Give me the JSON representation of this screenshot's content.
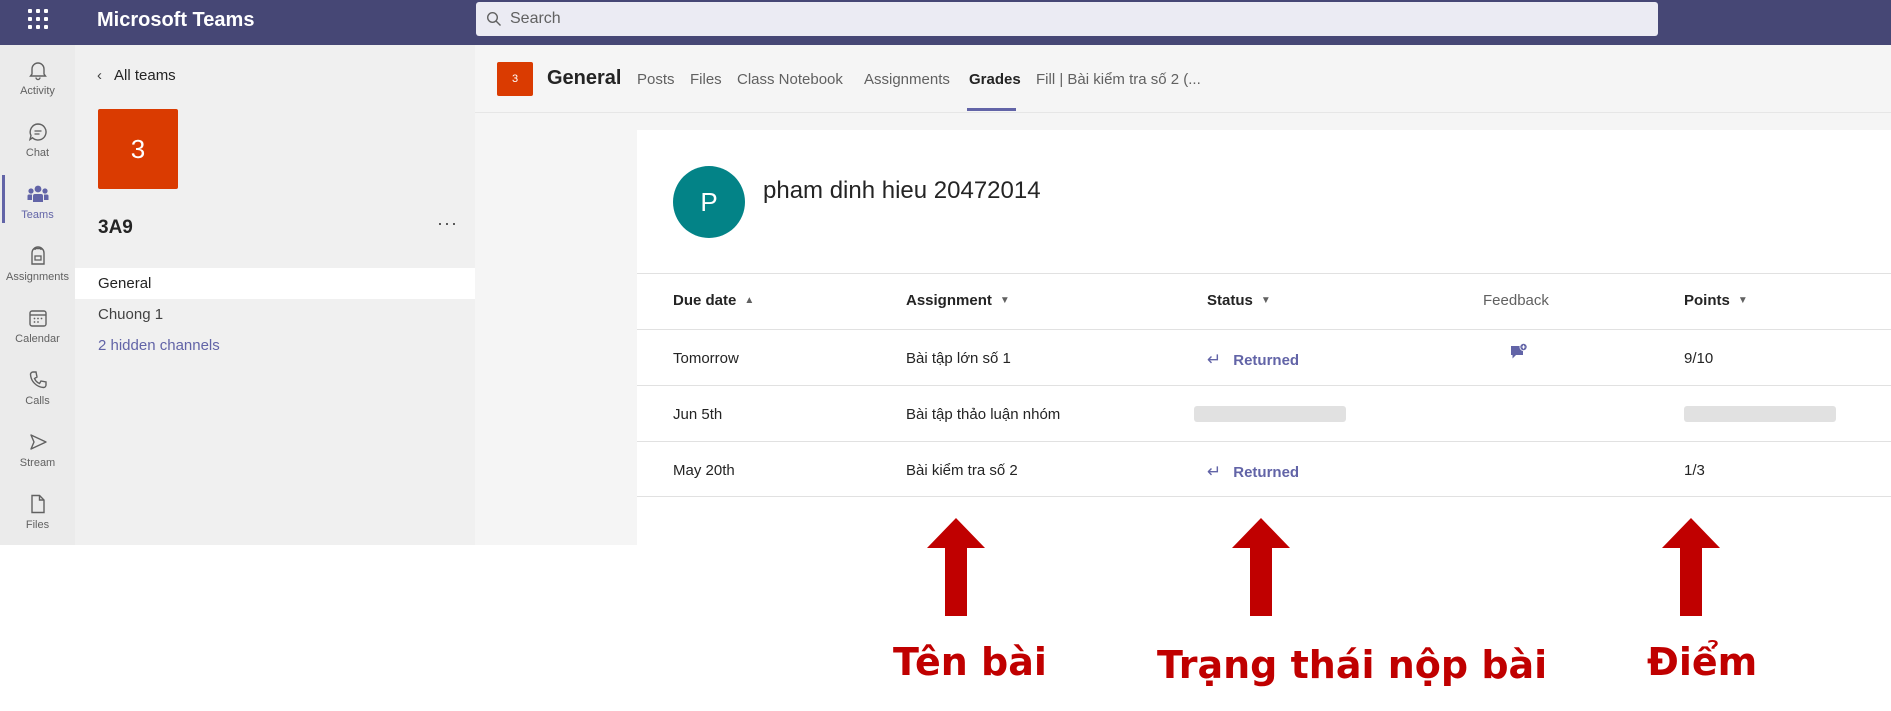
{
  "app": {
    "title": "Microsoft Teams"
  },
  "search": {
    "placeholder": "Search"
  },
  "rail": {
    "items": [
      {
        "label": "Activity",
        "icon": "bell-icon"
      },
      {
        "label": "Chat",
        "icon": "chat-icon"
      },
      {
        "label": "Teams",
        "icon": "teams-icon",
        "active": true
      },
      {
        "label": "Assignments",
        "icon": "assignments-icon"
      },
      {
        "label": "Calendar",
        "icon": "calendar-icon"
      },
      {
        "label": "Calls",
        "icon": "phone-icon"
      },
      {
        "label": "Stream",
        "icon": "stream-icon"
      },
      {
        "label": "Files",
        "icon": "file-icon"
      }
    ]
  },
  "team_panel": {
    "back_label": "All teams",
    "tile_text": "3",
    "team_name": "3A9",
    "more": "···",
    "channels": [
      {
        "label": "General",
        "active": true
      },
      {
        "label": "Chuong 1"
      },
      {
        "label": "2 hidden channels",
        "link": true
      }
    ]
  },
  "channel_header": {
    "icon_text": "3",
    "title": "General",
    "tabs": [
      {
        "label": "Posts"
      },
      {
        "label": "Files"
      },
      {
        "label": "Class Notebook"
      },
      {
        "label": "Assignments"
      },
      {
        "label": "Grades",
        "active": true
      },
      {
        "label": "Fill | Bài kiểm tra số 2 (..."
      }
    ]
  },
  "student": {
    "initial": "P",
    "name": "pham dinh hieu 20472014"
  },
  "grades_table": {
    "columns": [
      {
        "label": "Due date",
        "sort": "asc"
      },
      {
        "label": "Assignment",
        "sort": "menu"
      },
      {
        "label": "Status",
        "sort": "menu"
      },
      {
        "label": "Feedback"
      },
      {
        "label": "Points",
        "sort": "menu"
      }
    ],
    "rows": [
      {
        "due": "Tomorrow",
        "assignment": "Bài tập lớn số 1",
        "status": "Returned",
        "feedback": true,
        "points": "9/10"
      },
      {
        "due": "Jun 5th",
        "assignment": "Bài tập thảo luận nhóm",
        "status": null,
        "feedback": false,
        "points": null
      },
      {
        "due": "May 20th",
        "assignment": "Bài kiểm tra số 2",
        "status": "Returned",
        "feedback": false,
        "points": "1/3"
      }
    ]
  },
  "annotations": {
    "assignment_label": "Tên bài",
    "status_label": "Trạng thái nộp bài",
    "points_label": "Điểm",
    "color": "#c00000"
  },
  "colors": {
    "brand": "#464775",
    "accent": "#6264a7",
    "team": "#da3b01",
    "avatar": "#038387"
  }
}
